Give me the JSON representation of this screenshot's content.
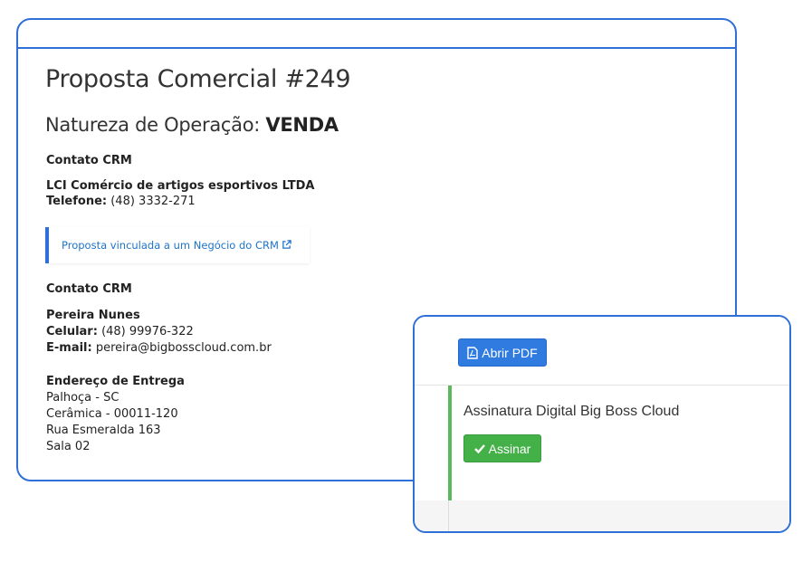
{
  "proposal": {
    "title": "Proposta Comercial #249",
    "natureza_label": "Natureza de Operação:",
    "natureza_value": "VENDA"
  },
  "contact1": {
    "heading": "Contato CRM",
    "company": "LCI Comércio de artigos esportivos LTDA",
    "phone_label": "Telefone:",
    "phone_value": "(48) 3332-271"
  },
  "alert": {
    "link_text": "Proposta vinculada a um Negócio do CRM",
    "icon": "external-link-icon",
    "accent_color": "#2f6fd8"
  },
  "contact2": {
    "heading": "Contato CRM",
    "name": "Pereira Nunes",
    "cell_label": "Celular:",
    "cell_value": "(48) 99976-322",
    "email_label": "E-mail:",
    "email_value": "pereira@bigbosscloud.com.br"
  },
  "delivery": {
    "heading": "Endereço de Entrega",
    "line1": "Palhoça - SC",
    "line2": "Cerâmica - 00011-120",
    "line3": "Rua Esmeralda 163",
    "line4": "Sala 02"
  },
  "popup": {
    "pdf_button": "Abrir PDF",
    "pdf_icon": "pdf-file-icon",
    "signature_title": "Assinatura Digital Big Boss Cloud",
    "sign_button": "Assinar",
    "sign_icon": "check-icon",
    "pdf_color": "#2f7be0",
    "sign_color": "#43b048"
  },
  "frame_color": "#2f6fd8"
}
